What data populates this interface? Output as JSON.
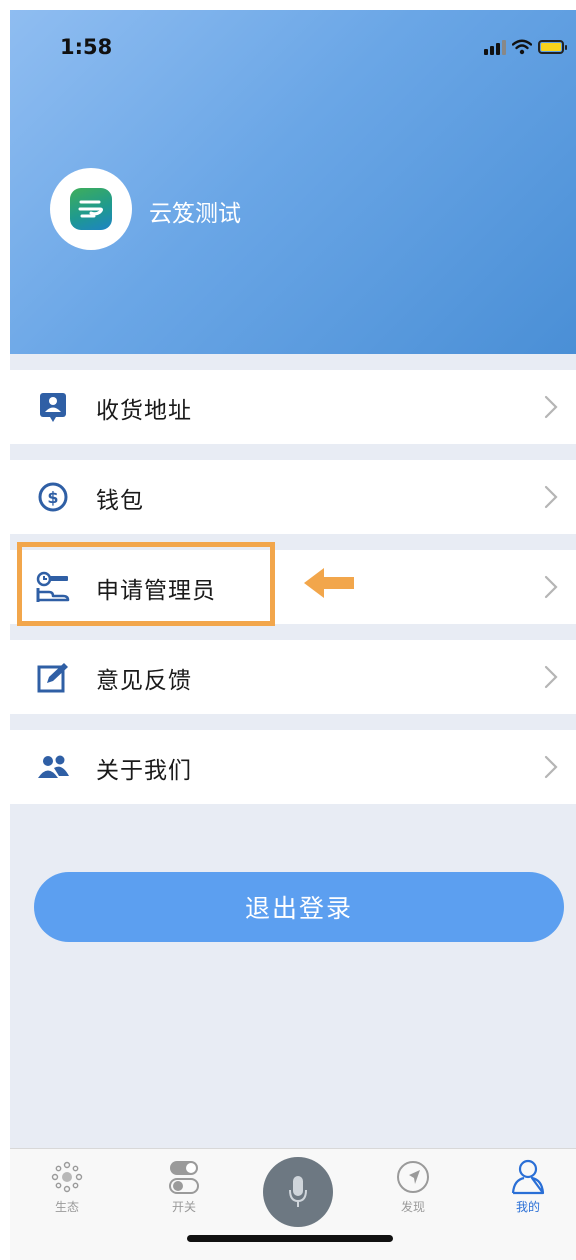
{
  "status_bar": {
    "time": "1:58"
  },
  "profile": {
    "name": "云笈测试"
  },
  "menu": [
    {
      "label": "收货地址",
      "icon": "location-card-icon"
    },
    {
      "label": "钱包",
      "icon": "dollar-coin-icon"
    },
    {
      "label": "申请管理员",
      "icon": "key-hand-icon"
    },
    {
      "label": "意见反馈",
      "icon": "edit-note-icon"
    },
    {
      "label": "关于我们",
      "icon": "people-icon"
    }
  ],
  "logout_label": "退出登录",
  "tabs": [
    {
      "label": "生态",
      "icon": "ecosystem-dots-icon"
    },
    {
      "label": "开关",
      "icon": "toggle-switches-icon"
    },
    {
      "label": "",
      "icon": "microphone-icon"
    },
    {
      "label": "发现",
      "icon": "compass-icon"
    },
    {
      "label": "我的",
      "icon": "person-icon"
    }
  ],
  "colors": {
    "header_gradient_start": "#8fbdf1",
    "header_gradient_end": "#4a8fd6",
    "highlight": "#f2a64b",
    "primary_button": "#5c9ff0",
    "active_tab": "#2a6fd6"
  }
}
